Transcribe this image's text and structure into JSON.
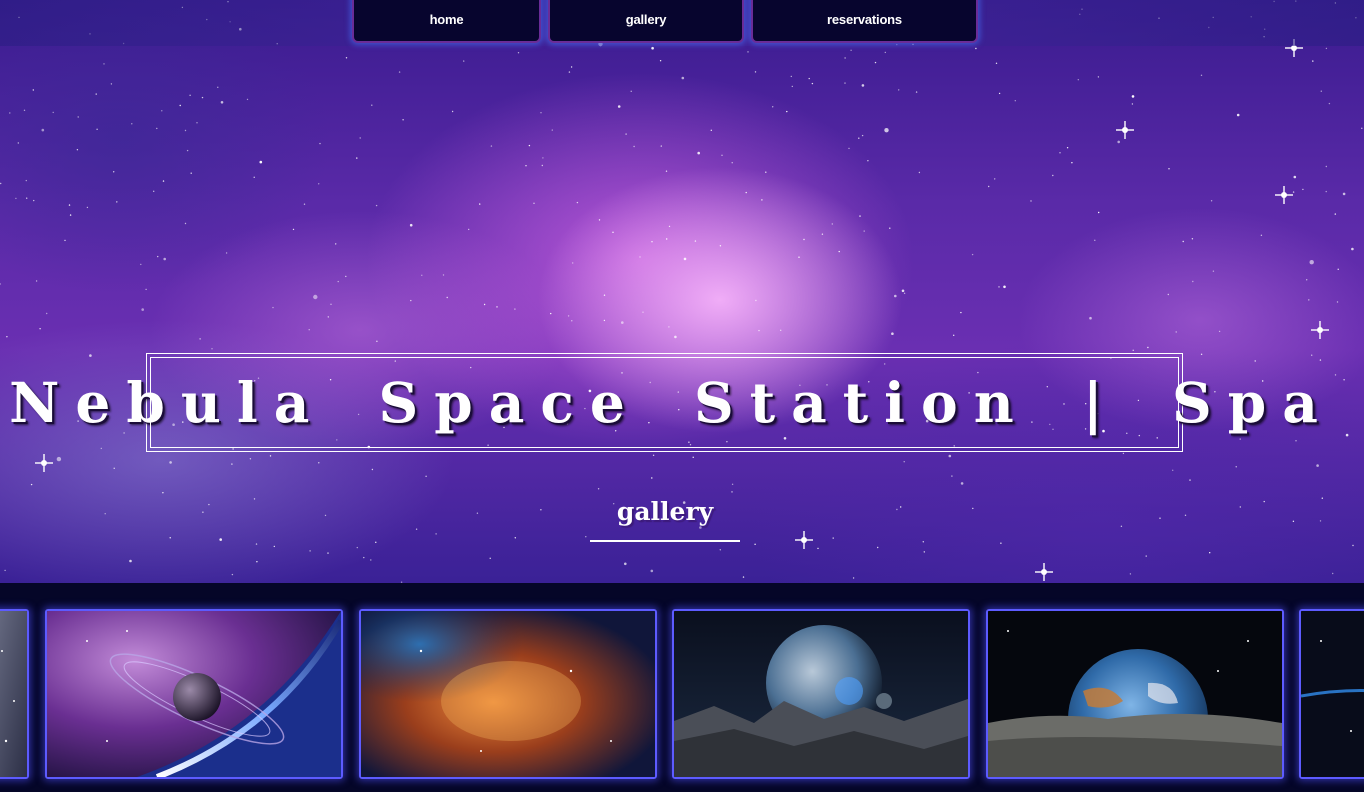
{
  "nav": {
    "items": [
      {
        "label": "home"
      },
      {
        "label": "gallery"
      },
      {
        "label": "reservations"
      }
    ]
  },
  "hero": {
    "title": "Nebula Space Station | Spa",
    "section_heading": "gallery"
  },
  "gallery": {
    "thumbnails": [
      {
        "subject": "partial space image (cut off left)"
      },
      {
        "subject": "ringed planet purple nebula"
      },
      {
        "subject": "orange galaxy nebula"
      },
      {
        "subject": "planet rising over rocky moon landscape"
      },
      {
        "subject": "earth rising over lunar surface"
      },
      {
        "subject": "partial space image (cut off right)"
      }
    ]
  },
  "colors": {
    "nav_bg": "#07052e",
    "nav_border": "#6a2c97",
    "thumb_border": "#5d5bff",
    "strip_bg": "#050628"
  }
}
